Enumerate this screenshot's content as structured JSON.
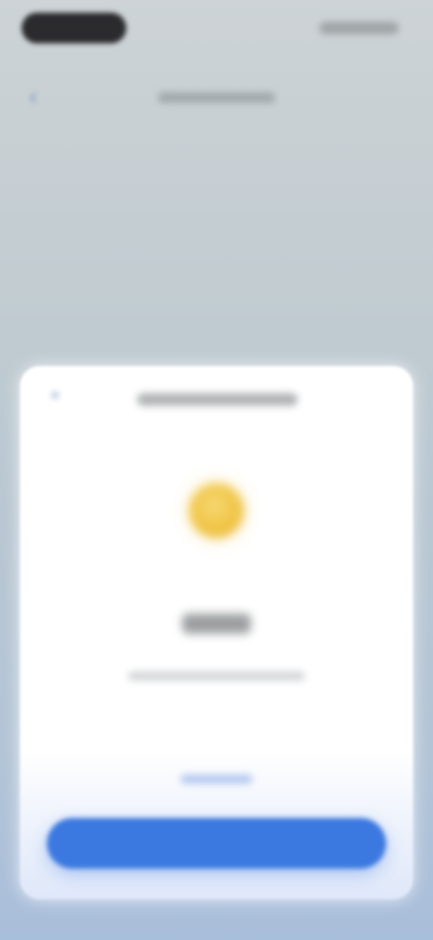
{
  "status_bar": {
    "time": "",
    "indicators": ""
  },
  "nav": {
    "back_icon": "chevron-left-icon",
    "title": ""
  },
  "dialog": {
    "close_icon": "close-icon",
    "title": "",
    "icon": "coin-icon",
    "status_text": "",
    "description": "",
    "secondary_link": "",
    "primary_button": ""
  },
  "colors": {
    "accent": "#3b78e0",
    "coin": "#f0c443",
    "background_top": "#cdd3d6",
    "background_bottom": "#a9bedb"
  }
}
